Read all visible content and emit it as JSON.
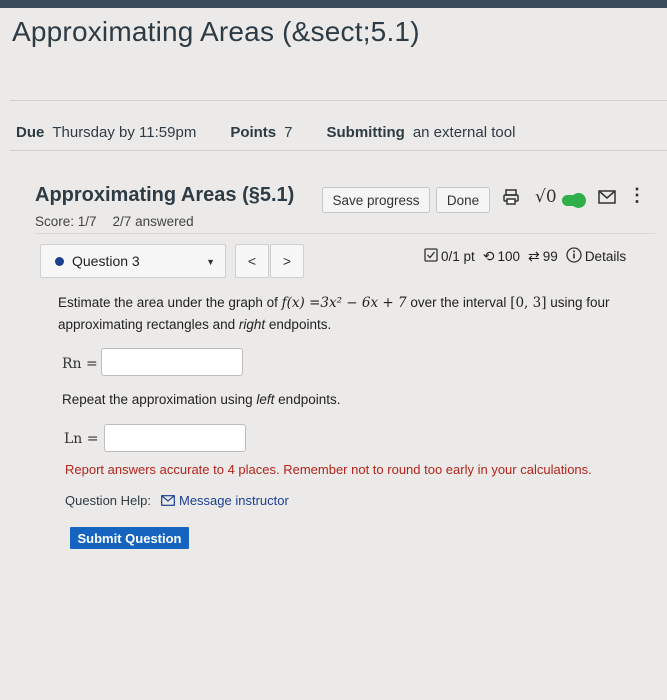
{
  "page": {
    "title": "Approximating Areas (&sect;5.1)"
  },
  "meta": {
    "due_label": "Due",
    "due_value": "Thursday by 11:59pm",
    "points_label": "Points",
    "points_value": "7",
    "submitting_label": "Submitting",
    "submitting_value": "an external tool"
  },
  "quiz": {
    "title": "Approximating Areas (§5.1)",
    "score": "Score: 1/7",
    "answered": "2/7 answered",
    "save_label": "Save progress",
    "done_label": "Done",
    "sqrt_label": "√0"
  },
  "question_nav": {
    "selected": "Question 3",
    "prev": "<",
    "next": ">"
  },
  "question_info": {
    "points": "0/1 pt",
    "attempts": "100",
    "retries": "99",
    "details": "Details"
  },
  "question": {
    "intro": "Estimate the area under the graph of",
    "function": "f(x) =3x² − 6x + 7",
    "interval_pre": "over the interval",
    "interval": "[0, 3]",
    "rest": "using four approximating rectangles and",
    "right_word": "right",
    "end": "endpoints.",
    "rn_label": "Rn =",
    "repeat_pre": "Repeat the approximation using",
    "left_word": "left",
    "repeat_end": "endpoints.",
    "ln_label": "Ln =",
    "rn_value": "",
    "ln_value": ""
  },
  "footer": {
    "warning": "Report answers accurate to 4 places. Remember not to round too early in your calculations.",
    "help_label": "Question Help:",
    "message_label": "Message instructor",
    "submit_label": "Submit Question"
  },
  "colors": {
    "accent": "#1565c0",
    "warning": "#b5241b",
    "toggle": "#2fae4a"
  }
}
